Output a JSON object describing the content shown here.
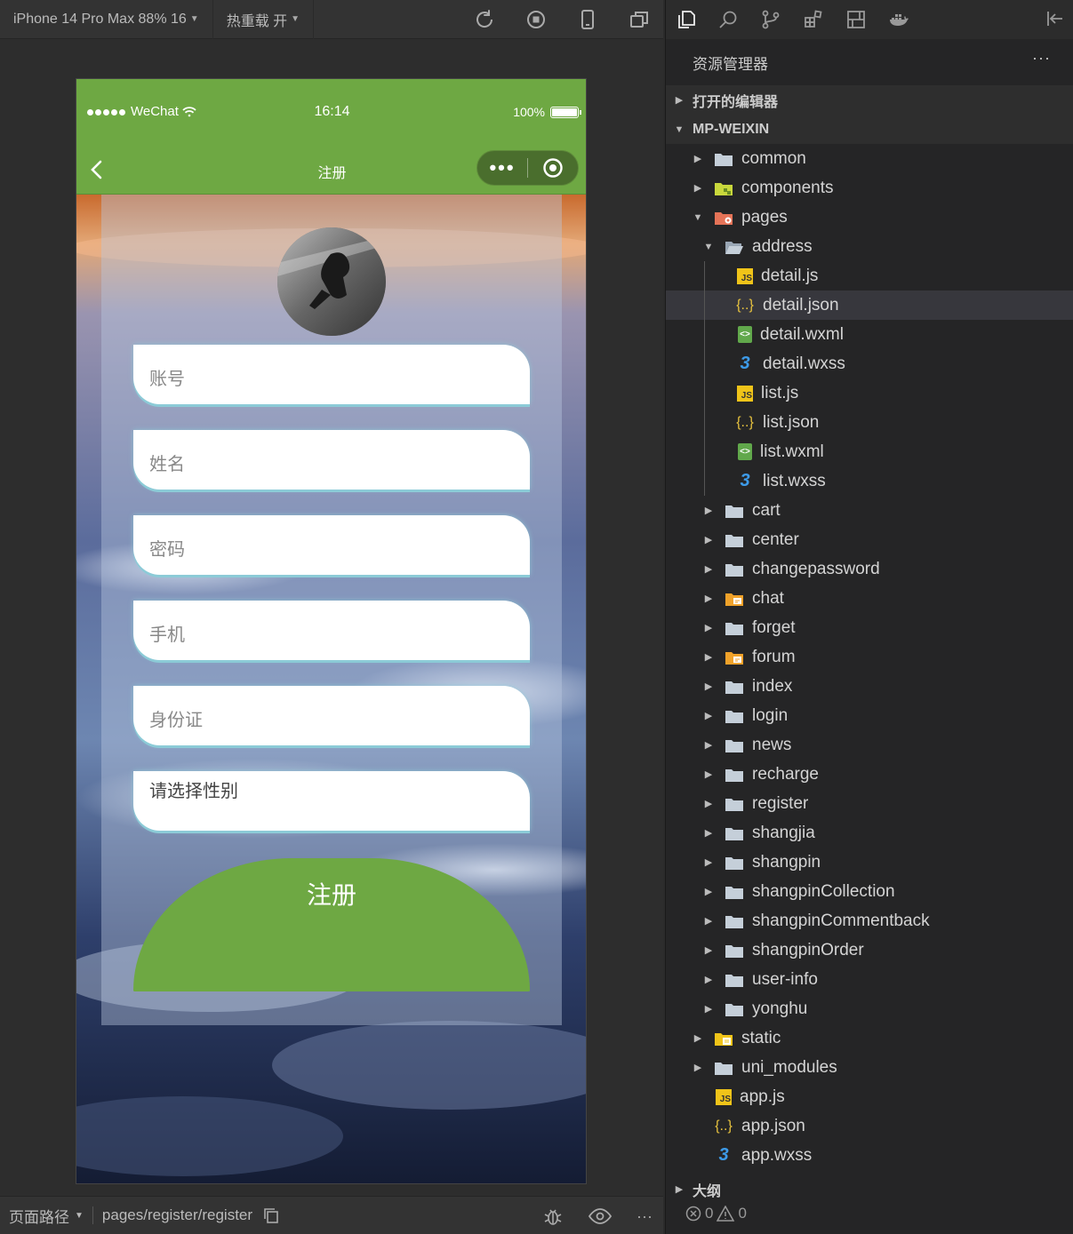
{
  "simulator": {
    "device_label": "iPhone 14 Pro Max 88% 16",
    "hot_reload_label": "热重载 开",
    "status_bar": {
      "carrier": "WeChat",
      "time": "16:14",
      "battery": "100%"
    },
    "nav": {
      "title": "注册"
    },
    "form": {
      "fields": [
        {
          "placeholder": "账号"
        },
        {
          "placeholder": "姓名"
        },
        {
          "placeholder": "密码"
        },
        {
          "placeholder": "手机"
        },
        {
          "placeholder": "身份证"
        },
        {
          "placeholder": "请选择性别"
        }
      ],
      "submit_label": "注册"
    },
    "bottom": {
      "path_label": "页面路径",
      "path_value": "pages/register/register"
    }
  },
  "explorer": {
    "title": "资源管理器",
    "more": "···",
    "open_editors": "打开的编辑器",
    "project": "MP-WEIXIN",
    "tree": [
      {
        "label": "common",
        "type": "folder",
        "depth": 0,
        "state": "collapsed"
      },
      {
        "label": "components",
        "type": "folder-components",
        "depth": 0,
        "state": "collapsed"
      },
      {
        "label": "pages",
        "type": "folder-pages",
        "depth": 0,
        "state": "expanded"
      },
      {
        "label": "address",
        "type": "folder-open",
        "depth": 1,
        "state": "expanded"
      },
      {
        "label": "detail.js",
        "type": "js",
        "depth": 2
      },
      {
        "label": "detail.json",
        "type": "json",
        "depth": 2,
        "selected": true
      },
      {
        "label": "detail.wxml",
        "type": "wxml",
        "depth": 2
      },
      {
        "label": "detail.wxss",
        "type": "wxss",
        "depth": 2
      },
      {
        "label": "list.js",
        "type": "js",
        "depth": 2
      },
      {
        "label": "list.json",
        "type": "json",
        "depth": 2
      },
      {
        "label": "list.wxml",
        "type": "wxml",
        "depth": 2
      },
      {
        "label": "list.wxss",
        "type": "wxss",
        "depth": 2
      },
      {
        "label": "cart",
        "type": "folder",
        "depth": 1,
        "state": "collapsed"
      },
      {
        "label": "center",
        "type": "folder",
        "depth": 1,
        "state": "collapsed"
      },
      {
        "label": "changepassword",
        "type": "folder",
        "depth": 1,
        "state": "collapsed"
      },
      {
        "label": "chat",
        "type": "folder-chat",
        "depth": 1,
        "state": "collapsed"
      },
      {
        "label": "forget",
        "type": "folder",
        "depth": 1,
        "state": "collapsed"
      },
      {
        "label": "forum",
        "type": "folder-chat",
        "depth": 1,
        "state": "collapsed"
      },
      {
        "label": "index",
        "type": "folder",
        "depth": 1,
        "state": "collapsed"
      },
      {
        "label": "login",
        "type": "folder",
        "depth": 1,
        "state": "collapsed"
      },
      {
        "label": "news",
        "type": "folder",
        "depth": 1,
        "state": "collapsed"
      },
      {
        "label": "recharge",
        "type": "folder",
        "depth": 1,
        "state": "collapsed"
      },
      {
        "label": "register",
        "type": "folder",
        "depth": 1,
        "state": "collapsed"
      },
      {
        "label": "shangjia",
        "type": "folder",
        "depth": 1,
        "state": "collapsed"
      },
      {
        "label": "shangpin",
        "type": "folder",
        "depth": 1,
        "state": "collapsed"
      },
      {
        "label": "shangpinCollection",
        "type": "folder",
        "depth": 1,
        "state": "collapsed"
      },
      {
        "label": "shangpinCommentback",
        "type": "folder",
        "depth": 1,
        "state": "collapsed"
      },
      {
        "label": "shangpinOrder",
        "type": "folder",
        "depth": 1,
        "state": "collapsed"
      },
      {
        "label": "user-info",
        "type": "folder",
        "depth": 1,
        "state": "collapsed"
      },
      {
        "label": "yonghu",
        "type": "folder",
        "depth": 1,
        "state": "collapsed"
      },
      {
        "label": "static",
        "type": "folder-static",
        "depth": 0,
        "state": "collapsed"
      },
      {
        "label": "uni_modules",
        "type": "folder",
        "depth": 0,
        "state": "collapsed"
      },
      {
        "label": "app.js",
        "type": "js",
        "depth": 0
      },
      {
        "label": "app.json",
        "type": "json",
        "depth": 0
      },
      {
        "label": "app.wxss",
        "type": "wxss",
        "depth": 0
      }
    ],
    "outline": "大纲",
    "problems": {
      "errors": "0",
      "warnings": "0"
    }
  },
  "colors": {
    "accent_green": "#6ea843",
    "folder": "#c5cfd9",
    "selected_row": "#37373d"
  }
}
